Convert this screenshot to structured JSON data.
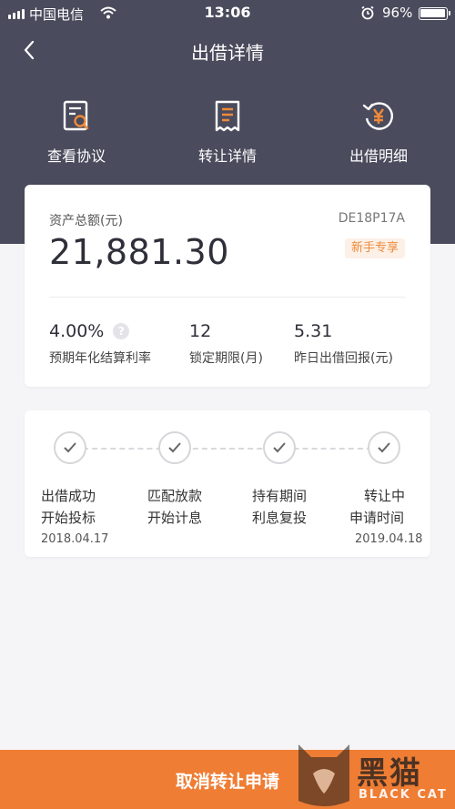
{
  "status_bar": {
    "carrier": "中国电信",
    "time": "13:06",
    "battery": "96%"
  },
  "nav": {
    "title": "出借详情"
  },
  "actions": [
    {
      "label": "查看协议",
      "icon": "document-search-icon"
    },
    {
      "label": "转让详情",
      "icon": "receipt-icon"
    },
    {
      "label": "出借明细",
      "icon": "yen-refresh-icon"
    }
  ],
  "summary": {
    "asset_label": "资产总额(元)",
    "asset_code": "DE18P17A",
    "asset_value": "21,881.30",
    "badge": "新手专享",
    "stats": [
      {
        "value": "4.00%",
        "label": "预期年化结算利率",
        "has_help": true
      },
      {
        "value": "12",
        "label": "锁定期限(月)"
      },
      {
        "value": "5.31",
        "label": "昨日出借回报(元)"
      }
    ]
  },
  "progress": {
    "steps": [
      {
        "line1": "出借成功",
        "line2": "开始投标",
        "date": "2018.04.17"
      },
      {
        "line1": "匹配放款",
        "line2": "开始计息",
        "date": ""
      },
      {
        "line1": "持有期间",
        "line2": "利息复投",
        "date": ""
      },
      {
        "line1": "转让中",
        "line2": "申请时间",
        "date": "2019.04.18"
      }
    ]
  },
  "bottom": {
    "button_label": "取消转让申请"
  },
  "watermark": {
    "cn": "黑猫",
    "en": "BLACK CAT"
  },
  "colors": {
    "header_bg": "#4a4b5c",
    "accent": "#ef7d34",
    "badge_text": "#ef8a3a",
    "badge_bg": "#fdf0e6"
  }
}
